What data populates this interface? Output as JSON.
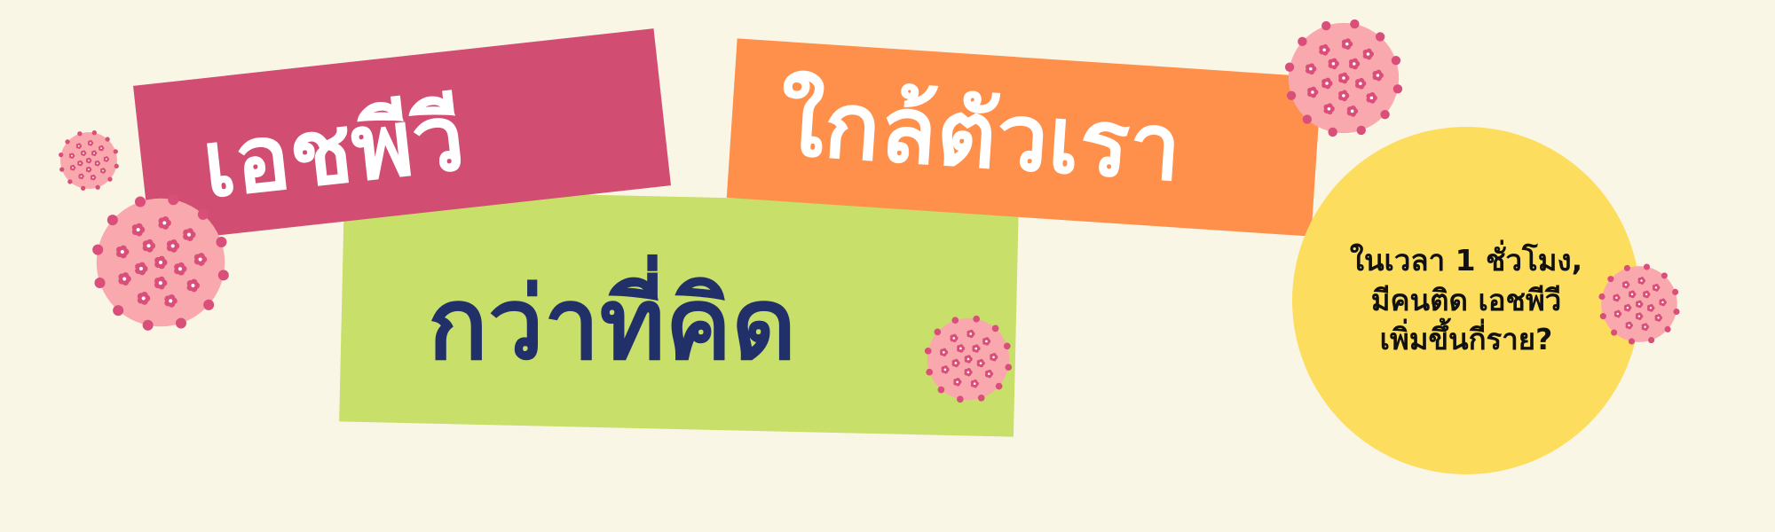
{
  "headline": {
    "line1": "เอชพีวี",
    "line2": "ใกล้ตัวเรา",
    "line3": "กว่าที่คิด"
  },
  "question": {
    "line1": "ในเวลา 1 ชั่วโมง,",
    "line2": "มีคนติด เอชพีวี",
    "line3": "เพิ่มขึ้นกี่ราย?"
  },
  "colors": {
    "background": "#faf6e6",
    "pink_block": "#d14e72",
    "orange_block": "#ff904c",
    "green_block": "#c8df6a",
    "navy_text": "#22306a",
    "yellow_circle": "#fddd5e",
    "virus_body": "#f9a9ad",
    "virus_spot": "#d94f79"
  },
  "icons": [
    "virus-icon"
  ]
}
